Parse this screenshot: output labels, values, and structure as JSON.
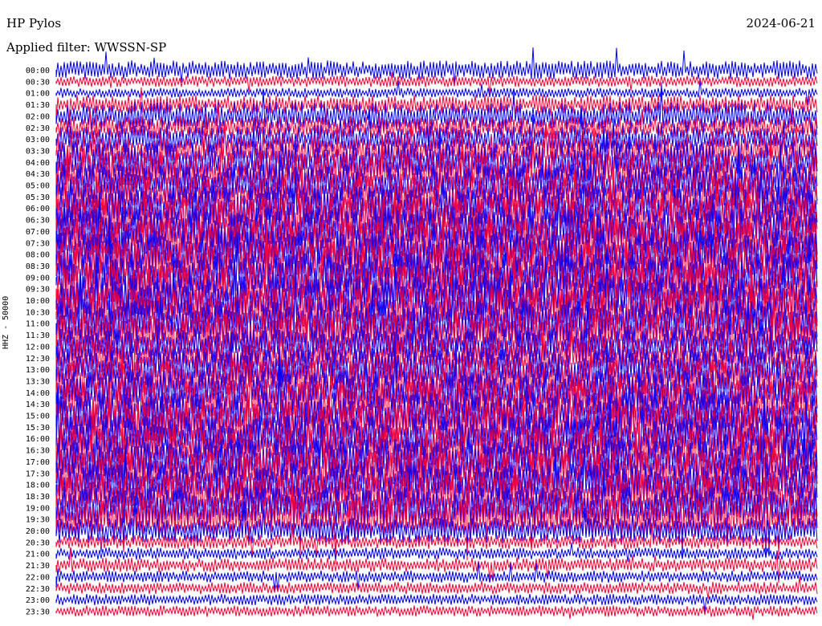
{
  "header": {
    "station": "HP Pylos",
    "filter": "Applied filter: WWSSN-SP",
    "date": "2024-06-21",
    "channel": "HHZ - 50000"
  },
  "colors": {
    "even_trace": "#0000ff",
    "odd_trace": "#ff0033",
    "background": "#ffffff"
  },
  "chart_data": {
    "type": "line",
    "title": "HP Pylos",
    "subtitle": "Applied filter: WWSSN-SP",
    "ylabel": "HHZ - 50000",
    "xlabel": "",
    "grid": false,
    "y_tick_labels": [
      "00:00",
      "00:30",
      "01:00",
      "01:30",
      "02:00",
      "02:30",
      "03:00",
      "03:30",
      "04:00",
      "04:30",
      "05:00",
      "05:30",
      "06:00",
      "06:30",
      "07:00",
      "07:30",
      "08:00",
      "08:30",
      "09:00",
      "09:30",
      "10:00",
      "10:30",
      "11:00",
      "11:30",
      "12:00",
      "12:30",
      "13:00",
      "13:30",
      "14:00",
      "14:30",
      "15:00",
      "15:30",
      "16:00",
      "16:30",
      "17:00",
      "17:30",
      "18:00",
      "18:30",
      "19:00",
      "19:30",
      "20:00",
      "20:30",
      "21:00",
      "21:30",
      "22:00",
      "22:30",
      "23:00",
      "23:30"
    ],
    "trace_activity_levels": [
      0.35,
      0.18,
      0.15,
      0.35,
      0.55,
      0.45,
      0.55,
      0.65,
      0.8,
      0.8,
      0.85,
      0.85,
      0.9,
      0.95,
      1,
      1,
      1,
      1,
      1,
      1,
      1,
      1,
      1,
      0.85,
      0.7,
      0.7,
      0.85,
      0.85,
      0.9,
      0.95,
      0.95,
      0.95,
      0.95,
      0.95,
      0.95,
      0.9,
      0.9,
      0.9,
      0.85,
      0.8,
      0.5,
      0.25,
      0.2,
      0.25,
      0.2,
      0.2,
      0.18,
      0.18
    ]
  }
}
